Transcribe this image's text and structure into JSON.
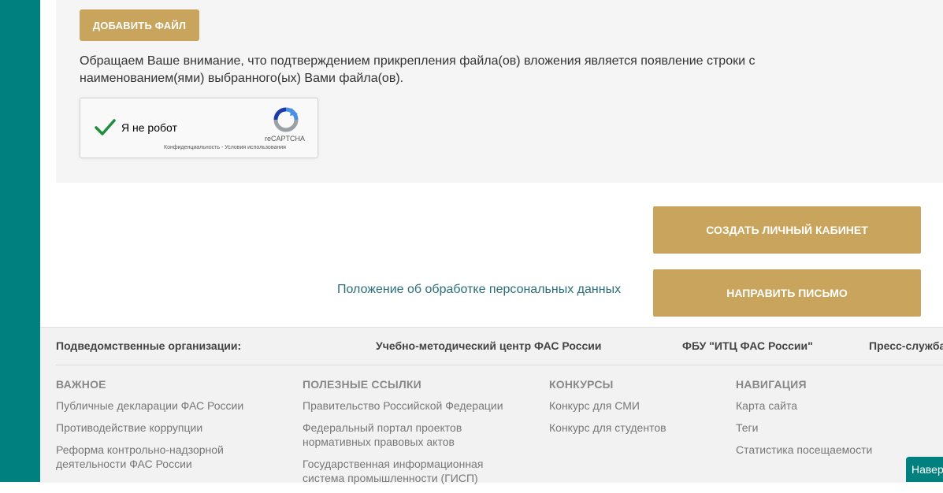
{
  "form": {
    "add_file_label": "ДОБАВИТЬ ФАЙЛ",
    "notice": "Обращаем Ваше внимание, что подтверждением прикрепления файла(ов) вложения является появление строки с наименованием(ями) выбранного(ых) Вами файла(ов).",
    "captcha": {
      "label": "Я не робот",
      "brand": "reCAPTCHA",
      "terms": "Конфиденциальность - Условия использования",
      "checked": true
    }
  },
  "actions": {
    "create_label": "СОЗДАТЬ ЛИЧНЫЙ КАБИНЕТ",
    "send_label": "НАПРАВИТЬ ПИСЬМО",
    "privacy_link": "Положение об обработке персональных данных"
  },
  "footer": {
    "subordinate_label": "Подведомственные организации:",
    "subordinate_items": [
      "Учебно-методический центр ФАС России",
      "ФБУ \"ИТЦ ФАС России\"",
      "Пресс-служба"
    ],
    "columns": [
      {
        "title": "ВАЖНОЕ",
        "links": [
          "Публичные декларации ФАС России",
          "Противодействие коррупции",
          "Реформа контрольно-надзорной деятельности ФАС России"
        ]
      },
      {
        "title": "ПОЛЕЗНЫЕ ССЫЛКИ",
        "links": [
          "Правительство Российской Федерации",
          "Федеральный портал проектов нормативных правовых актов",
          "Государственная информационная система промышленности (ГИСП)"
        ]
      },
      {
        "title": "КОНКУРСЫ",
        "links": [
          "Конкурс для СМИ",
          "Конкурс для студентов"
        ]
      },
      {
        "title": "НАВИГАЦИЯ",
        "links": [
          "Карта сайта",
          "Теги",
          "Статистика посещаемости"
        ]
      }
    ],
    "nav_up_label": "Наверх"
  },
  "colors": {
    "accent": "#c9a45c",
    "teal": "#00807f",
    "link": "#2c6e79"
  }
}
